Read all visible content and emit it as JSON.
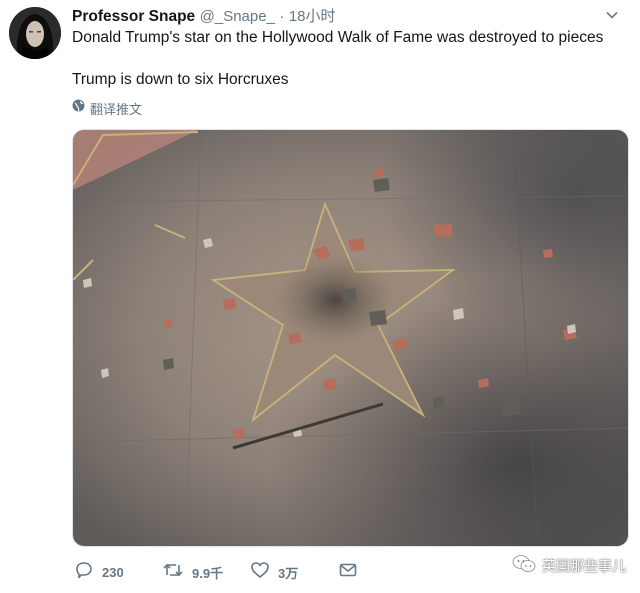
{
  "tweet": {
    "author_name": "Professor Snape",
    "handle": "@_Snape_",
    "separator": "·",
    "time": "18小时",
    "text_line1": "Donald Trump's star on the Hollywood Walk of Fame was destroyed to pieces",
    "text_line2": "Trump is down to six Horcruxes",
    "translate_label": "翻译推文"
  },
  "actions": {
    "reply_count": "230",
    "retweet_count": "9.9千",
    "like_count": "3万"
  },
  "icons": {
    "globe": "globe-icon",
    "reply": "reply-icon",
    "retweet": "retweet-icon",
    "like": "heart-icon",
    "dm": "envelope-icon",
    "caret": "chevron-down-icon",
    "watermark": "wechat-icon"
  },
  "watermark": {
    "text": "英国那些事儿"
  },
  "colors": {
    "text": "#14171a",
    "secondary": "#657786",
    "border": "#dfe3e6"
  }
}
